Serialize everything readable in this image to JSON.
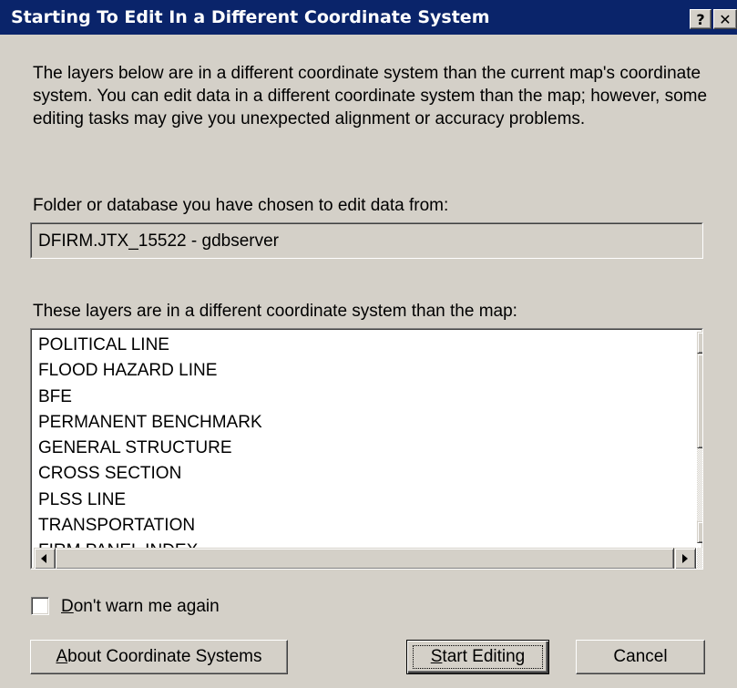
{
  "window": {
    "title": "Starting To Edit In a Different Coordinate System",
    "help_glyph": "?",
    "close_glyph": "✕"
  },
  "message": "The layers below are in a different coordinate system than the current map's coordinate system. You can edit data in a different coordinate system than the map; however, some editing tasks may give you unexpected alignment or accuracy problems.",
  "folder": {
    "label": "Folder or database you have chosen to edit data from:",
    "value": "DFIRM.JTX_15522 - gdbserver"
  },
  "layers": {
    "label": "These layers are in a different coordinate system than the map:",
    "items": [
      "POLITICAL LINE",
      "FLOOD HAZARD LINE",
      "BFE",
      "PERMANENT BENCHMARK",
      "GENERAL STRUCTURE",
      "CROSS SECTION",
      "PLSS LINE",
      "TRANSPORTATION",
      "FIRM PANEL INDEX"
    ]
  },
  "dont_warn": {
    "mnemonic": "D",
    "rest": "on't warn me again",
    "checked": false
  },
  "buttons": {
    "about_mnemonic": "A",
    "about_rest": "bout Coordinate Systems",
    "start_mnemonic": "S",
    "start_rest": "tart Editing",
    "cancel": "Cancel"
  }
}
